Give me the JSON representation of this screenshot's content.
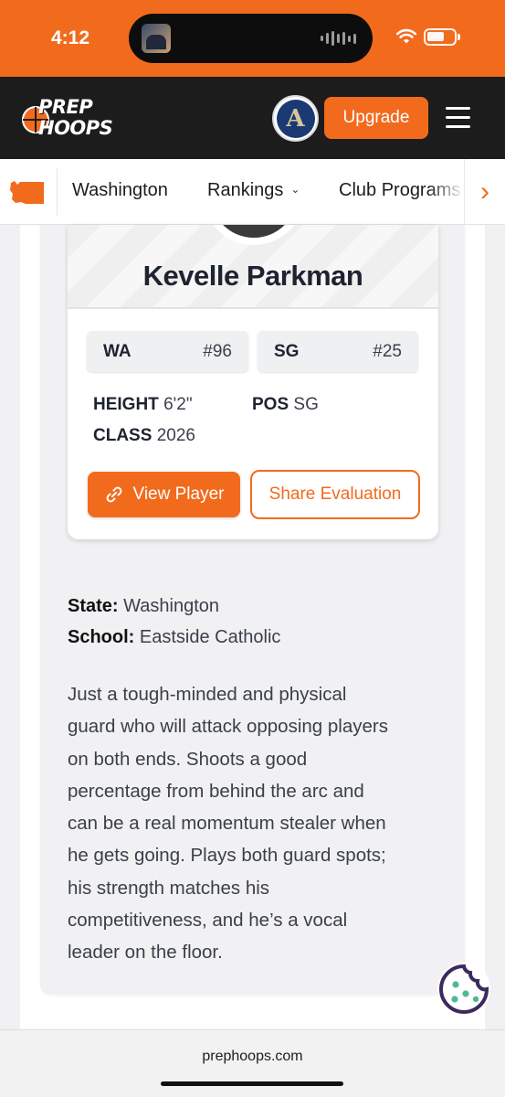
{
  "status_bar": {
    "time": "4:12"
  },
  "header": {
    "logo_line1": "PREP",
    "logo_line2": "HOOPS",
    "upgrade_label": "Upgrade",
    "avatar_letter": "A"
  },
  "nav": {
    "items": [
      "Washington",
      "Rankings",
      "Club Programs"
    ]
  },
  "player": {
    "name": "Kevelle Parkman",
    "state_rank": {
      "label": "WA",
      "value": "#96"
    },
    "position_rank": {
      "label": "SG",
      "value": "#25"
    },
    "height_label": "HEIGHT",
    "height": "6'2\"",
    "pos_label": "POS",
    "pos": "SG",
    "class_label": "CLASS",
    "class": "2026",
    "view_label": "View Player",
    "share_label": "Share Evaluation"
  },
  "details": {
    "state_label": "State:",
    "state": "Washington",
    "school_label": "School:",
    "school": "Eastside Catholic",
    "lines": [
      "Just a tough-minded and physical",
      "guard who will attack opposing players",
      "on both ends. Shoots a good",
      "percentage from behind the arc and",
      "can be a real momentum stealer when",
      "he gets going. Plays both guard spots;",
      "his strength matches his",
      "competitiveness, and he’s a vocal",
      "leader on the floor."
    ]
  },
  "browser": {
    "url": "prephoops.com"
  },
  "colors": {
    "brand": "#f26b1d",
    "header_bg": "#1c1c1c",
    "cookie": "#3b2a5e",
    "cookie_dots": "#4fb89a"
  },
  "icons": [
    "wifi-icon",
    "battery-icon",
    "menu-icon",
    "washington-state-icon",
    "chevron-down-icon",
    "chevron-right-icon",
    "link-icon",
    "cookie-icon"
  ]
}
